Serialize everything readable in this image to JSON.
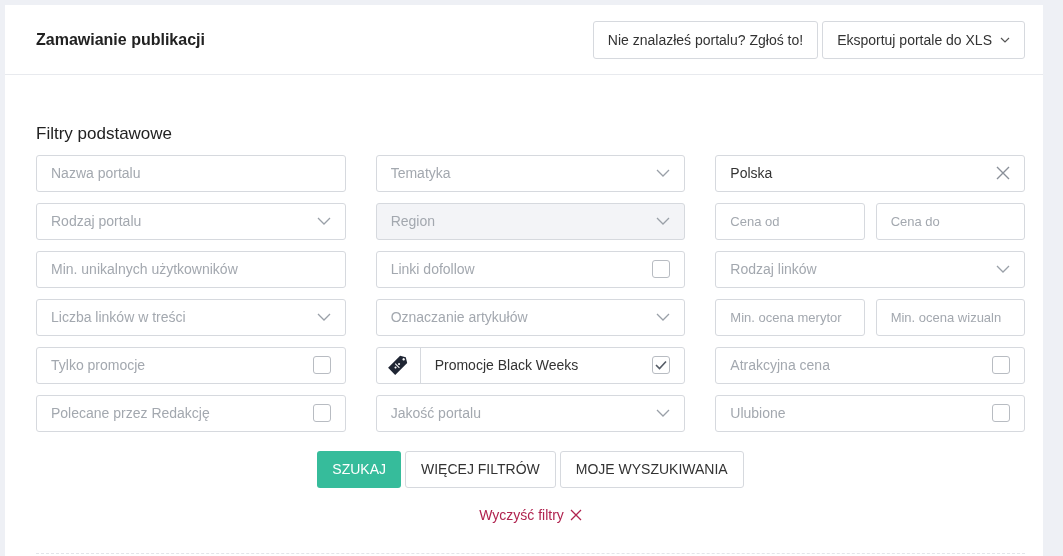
{
  "header": {
    "title": "Zamawianie publikacji",
    "buttons": [
      {
        "label": "Nie znalazłeś portalu? Zgłoś to!",
        "kind": "plain"
      },
      {
        "label": "Eksportuj portale do XLS",
        "kind": "dropdown"
      }
    ]
  },
  "filters": {
    "title": "Filtry podstawowe",
    "rows": [
      [
        {
          "kind": "text",
          "placeholder": "Nazwa portalu"
        },
        {
          "kind": "select",
          "placeholder": "Tematyka",
          "disabled": false
        },
        {
          "kind": "clearable",
          "value": "Polska"
        }
      ],
      [
        {
          "kind": "select",
          "placeholder": "Rodzaj portalu",
          "disabled": false
        },
        {
          "kind": "select",
          "placeholder": "Region",
          "disabled": true
        },
        {
          "kind": "pair",
          "placeholders": [
            "Cena od",
            "Cena do"
          ]
        }
      ],
      [
        {
          "kind": "text",
          "placeholder": "Min. unikalnych użytkowników"
        },
        {
          "kind": "checkbox",
          "label": "Linki dofollow",
          "checked": false
        },
        {
          "kind": "select",
          "placeholder": "Rodzaj linków",
          "disabled": false
        }
      ],
      [
        {
          "kind": "select",
          "placeholder": "Liczba linków w treści",
          "disabled": false
        },
        {
          "kind": "select",
          "placeholder": "Oznaczanie artykułów",
          "disabled": false
        },
        {
          "kind": "pair",
          "placeholders": [
            "Min. ocena merytor",
            "Min. ocena wizualn"
          ]
        }
      ],
      [
        {
          "kind": "checkbox",
          "label": "Tylko promocje",
          "checked": false
        },
        {
          "kind": "promo",
          "label": "Promocje Black Weeks",
          "checked": true
        },
        {
          "kind": "checkbox",
          "label": "Atrakcyjna cena",
          "checked": false
        }
      ],
      [
        {
          "kind": "checkbox",
          "label": "Polecane przez Redakcję",
          "checked": false
        },
        {
          "kind": "select",
          "placeholder": "Jakość portalu",
          "disabled": false
        },
        {
          "kind": "checkbox",
          "label": "Ulubione",
          "checked": false
        }
      ]
    ]
  },
  "actions": [
    {
      "label": "SZUKAJ",
      "kind": "primary"
    },
    {
      "label": "WIĘCEJ FILTRÓW",
      "kind": "secondary"
    },
    {
      "label": "MOJE WYSZUKIWANIA",
      "kind": "secondary"
    }
  ],
  "clear_link": "Wyczyść filtry"
}
